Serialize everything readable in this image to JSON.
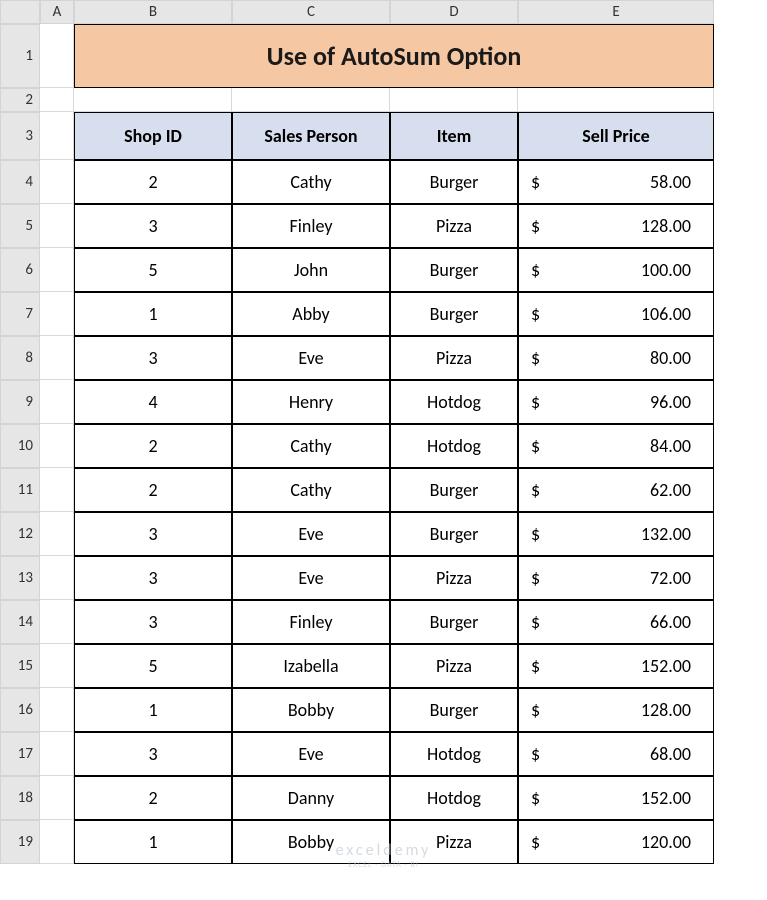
{
  "columns": [
    "A",
    "B",
    "C",
    "D",
    "E"
  ],
  "rows": [
    "1",
    "2",
    "3",
    "4",
    "5",
    "6",
    "7",
    "8",
    "9",
    "10",
    "11",
    "12",
    "13",
    "14",
    "15",
    "16",
    "17",
    "18",
    "19"
  ],
  "title": "Use of AutoSum Option",
  "headers": {
    "b": "Shop ID",
    "c": "Sales Person",
    "d": "Item",
    "e": "Sell Price"
  },
  "currency": "$",
  "data": [
    {
      "shop": "2",
      "person": "Cathy",
      "item": "Burger",
      "price": "58.00"
    },
    {
      "shop": "3",
      "person": "Finley",
      "item": "Pizza",
      "price": "128.00"
    },
    {
      "shop": "5",
      "person": "John",
      "item": "Burger",
      "price": "100.00"
    },
    {
      "shop": "1",
      "person": "Abby",
      "item": "Burger",
      "price": "106.00"
    },
    {
      "shop": "3",
      "person": "Eve",
      "item": "Pizza",
      "price": "80.00"
    },
    {
      "shop": "4",
      "person": "Henry",
      "item": "Hotdog",
      "price": "96.00"
    },
    {
      "shop": "2",
      "person": "Cathy",
      "item": "Hotdog",
      "price": "84.00"
    },
    {
      "shop": "2",
      "person": "Cathy",
      "item": "Burger",
      "price": "62.00"
    },
    {
      "shop": "3",
      "person": "Eve",
      "item": "Burger",
      "price": "132.00"
    },
    {
      "shop": "3",
      "person": "Eve",
      "item": "Pizza",
      "price": "72.00"
    },
    {
      "shop": "3",
      "person": "Finley",
      "item": "Burger",
      "price": "66.00"
    },
    {
      "shop": "5",
      "person": "Izabella",
      "item": "Pizza",
      "price": "152.00"
    },
    {
      "shop": "1",
      "person": "Bobby",
      "item": "Burger",
      "price": "128.00"
    },
    {
      "shop": "3",
      "person": "Eve",
      "item": "Hotdog",
      "price": "68.00"
    },
    {
      "shop": "2",
      "person": "Danny",
      "item": "Hotdog",
      "price": "152.00"
    },
    {
      "shop": "1",
      "person": "Bobby",
      "item": "Pizza",
      "price": "120.00"
    }
  ],
  "watermark": {
    "line1": "exceldemy",
    "line2": "EXCEL · DATA · BI"
  }
}
